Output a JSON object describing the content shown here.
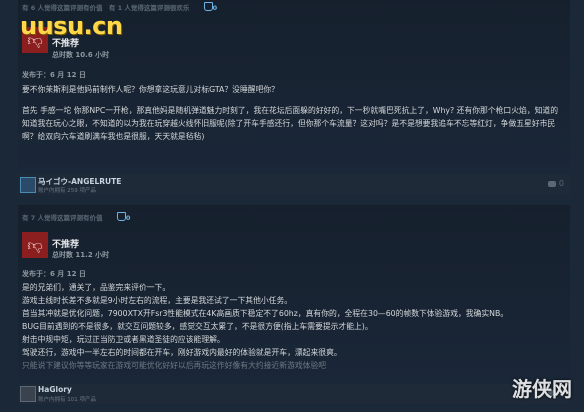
{
  "review1": {
    "helpful": "有 6 人觉得这篇评测有价值",
    "helpful_funny": "有 1 人觉得这篇评测很欢乐",
    "award_count": "0",
    "verdict": "不推荐",
    "hours": "总时数 10.6 小时",
    "posted": "发布于：6 月 12 日",
    "paragraphs": [
      "要不你茉斯利是他妈前制作人呢？你想拿这玩意儿对标GTA？没睡醒吧你？",
      "首先 手感一坨 你那NPC一开枪，那真他妈是随机弹道魅力时刻了，我在花坛后面躲的好好的，下一秒就嘴巴死抗上了，Why? 还有你那个枪口火焰，知道的知道我在玩心之眼，不知道的以为我在玩穿越火线怀旧服呢(除了开车手感还行，但你那个车流量？这对吗？是不是想要我追车不忘等红灯，争做五星好市民啊？给双向六车道刷满车我也是很服，天天就是毡毡)"
    ],
    "author": "马イゴウ-ANGELRUTE",
    "author_games": "账户内拥有 259 项产品",
    "comments": "0"
  },
  "review2": {
    "helpful": "有 7 人觉得这篇评测有价值",
    "award_count": "0",
    "verdict": "不推荐",
    "hours": "总时数 11.2 小时",
    "posted": "发布于：6 月 12 日",
    "paragraphs": [
      "是的兄弟们，通关了，品鉴完来评价一下。",
      "游戏主线时长差不多就是9小时左右的流程，主要是我还试了一下其他小任务。",
      "首当其冲就是优化问题，7900XTX开Fsr3性能模式在4K高画质下稳定不了60hz，真有你的，全程在30—60的帧数下体验游戏，我确实NB。",
      "BUG目前遇到的不是很多，就交互问题较多，感觉交互太累了，不是很方便(指上车需要提示才能上)。",
      "射击中规中矩，玩过正当防卫或者黑道圣徒的应该能理解。",
      "驾驶还行，游戏中一半左右的时间都在开车，刚好游戏内最好的体验就是开车，漂起来很爽。",
      "只能说下建议你等等玩家在游戏可能优化好好以后再玩这作好像有大约接近新游戏体验吧"
    ],
    "author": "HaGlory",
    "author_games": "账户内拥有 101 项产品",
    "comments": "0"
  },
  "watermarks": {
    "top_left": "uusu.cn",
    "bottom_right": "游侠网"
  }
}
